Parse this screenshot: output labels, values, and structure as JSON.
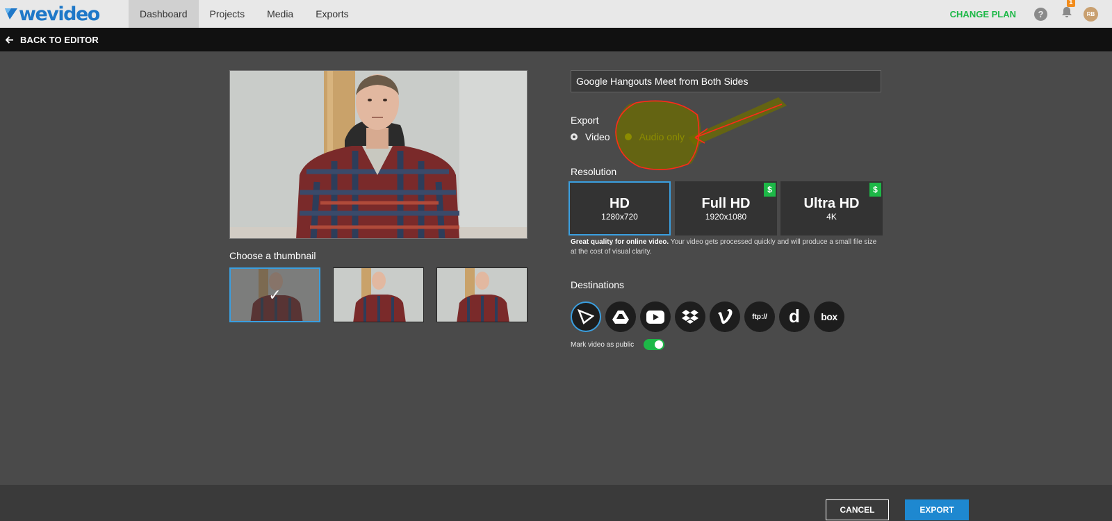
{
  "brand": {
    "name": "wevideo"
  },
  "nav": {
    "tabs": [
      {
        "label": "Dashboard",
        "active": true
      },
      {
        "label": "Projects",
        "active": false
      },
      {
        "label": "Media",
        "active": false
      },
      {
        "label": "Exports",
        "active": false
      }
    ],
    "change_plan": "CHANGE PLAN",
    "help": "?",
    "notifications_count": "1",
    "avatar_initials": "RB"
  },
  "back_bar": {
    "label": "BACK TO EDITOR"
  },
  "thumbnails": {
    "title": "Choose a thumbnail",
    "selected_index": 0
  },
  "export_settings": {
    "title_value": "Google Hangouts Meet from Both Sides",
    "export_label": "Export",
    "export_options": [
      {
        "label": "Video",
        "selected": false
      },
      {
        "label": "Audio only",
        "selected": true
      }
    ],
    "resolution_label": "Resolution",
    "resolutions": [
      {
        "name": "HD",
        "size": "1280x720",
        "premium": false,
        "selected": true
      },
      {
        "name": "Full HD",
        "size": "1920x1080",
        "premium": true,
        "selected": false
      },
      {
        "name": "Ultra HD",
        "size": "4K",
        "premium": true,
        "selected": false
      }
    ],
    "premium_symbol": "$",
    "resolution_desc_bold": "Great quality for online video.",
    "resolution_desc_rest": " Your video gets processed quickly and will produce a small file size at the cost of visual clarity.",
    "destinations_label": "Destinations",
    "destinations": [
      "wevideo-icon",
      "google-drive-icon",
      "youtube-icon",
      "dropbox-icon",
      "vimeo-icon",
      "ftp-icon",
      "dailymotion-icon",
      "box-icon"
    ],
    "destination_texts": {
      "ftp": "ftp://",
      "dailymotion": "d",
      "box": "box"
    },
    "mark_public_label": "Mark video as public",
    "mark_public": true
  },
  "footer": {
    "cancel": "CANCEL",
    "export": "EXPORT"
  },
  "colors": {
    "accent": "#3a9fe0",
    "green": "#1db847",
    "export_blue": "#1e88d0",
    "highlight": "#e6e600",
    "annotation_red": "#ff2a1a"
  }
}
